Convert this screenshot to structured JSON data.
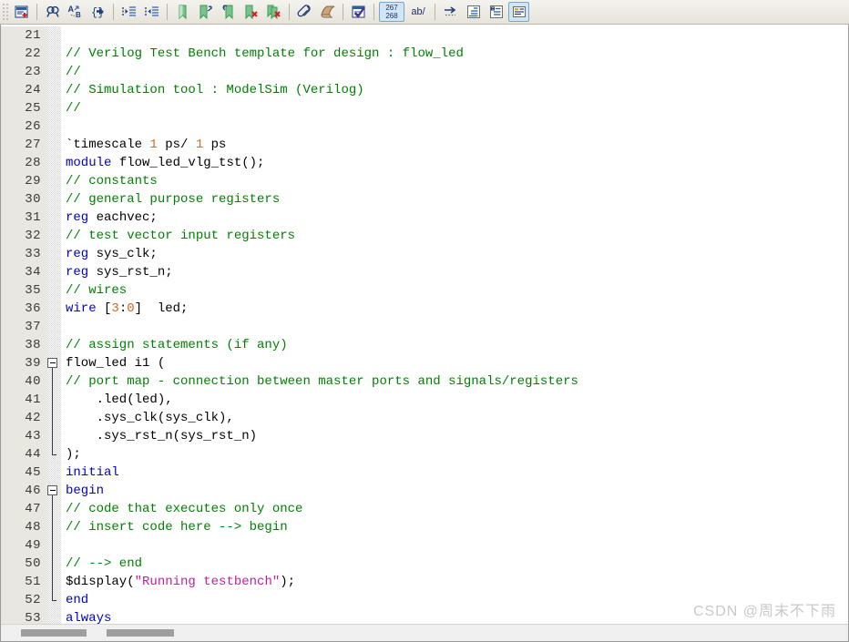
{
  "toolbar": {
    "items": [
      {
        "name": "insert-template-icon",
        "label": "Insert Template",
        "type": "icon",
        "active": false
      },
      {
        "name": "separator",
        "label": "",
        "type": "sep",
        "active": false
      },
      {
        "name": "find-icon",
        "label": "Find",
        "type": "icon",
        "active": false
      },
      {
        "name": "find-replace-icon",
        "label": "Find and Replace",
        "type": "icon",
        "active": false
      },
      {
        "name": "find-matching-delimiter-icon",
        "label": "Find Matching Delimiter",
        "type": "icon",
        "active": false
      },
      {
        "name": "separator",
        "label": "",
        "type": "sep",
        "active": false
      },
      {
        "name": "increase-indent-icon",
        "label": "Increase Indent",
        "type": "icon",
        "active": false
      },
      {
        "name": "decrease-indent-icon",
        "label": "Decrease Indent",
        "type": "icon",
        "active": false
      },
      {
        "name": "separator",
        "label": "",
        "type": "sep",
        "active": false
      },
      {
        "name": "insert-bookmark-icon",
        "label": "Insert Bookmark",
        "type": "icon",
        "active": false
      },
      {
        "name": "next-bookmark-icon",
        "label": "Next Bookmark",
        "type": "icon",
        "active": false
      },
      {
        "name": "previous-bookmark-icon",
        "label": "Previous Bookmark",
        "type": "icon",
        "active": false
      },
      {
        "name": "delete-bookmark-icon",
        "label": "Delete Bookmark",
        "type": "icon",
        "active": false
      },
      {
        "name": "delete-all-bookmarks-icon",
        "label": "Delete All Bookmarks",
        "type": "icon",
        "active": false
      },
      {
        "name": "separator",
        "label": "",
        "type": "sep",
        "active": false
      },
      {
        "name": "paperclip-icon",
        "label": "Attach",
        "type": "icon",
        "active": false
      },
      {
        "name": "scroll-icon",
        "label": "Insert File",
        "type": "icon",
        "active": false
      },
      {
        "name": "separator",
        "label": "",
        "type": "sep",
        "active": false
      },
      {
        "name": "check-syntax-icon",
        "label": "Check Syntax",
        "type": "icon",
        "active": false
      },
      {
        "name": "separator",
        "label": "",
        "type": "sep",
        "active": false
      },
      {
        "name": "line-numbers-icon",
        "label": "267 268",
        "type": "num",
        "active": true,
        "top": "267",
        "bottom": "268"
      },
      {
        "name": "toggle-word-wrap-icon",
        "label": "ab/",
        "type": "text",
        "active": false
      },
      {
        "name": "separator",
        "label": "",
        "type": "sep",
        "active": false
      },
      {
        "name": "show-whitespace-icon",
        "label": "Show Whitespace",
        "type": "icon",
        "active": false
      },
      {
        "name": "collapse-all-icon",
        "label": "Collapse All",
        "type": "icon",
        "active": false
      },
      {
        "name": "expand-all-icon",
        "label": "Expand All",
        "type": "icon",
        "active": false
      },
      {
        "name": "toggle-code-folding-icon",
        "label": "Toggle Code Folding",
        "type": "icon",
        "active": true
      }
    ]
  },
  "editor": {
    "language": "verilog",
    "colors": {
      "comment": "#008000",
      "keyword": "#0000c8",
      "number": "#d2691e",
      "string": "#c020a0",
      "plain": "#000000",
      "gutter_bg": "#e8e8e0",
      "editor_bg": "#ffffff"
    },
    "lines": [
      {
        "n": "21",
        "fold": "none",
        "tokens": []
      },
      {
        "n": "22",
        "fold": "none",
        "tokens": [
          {
            "t": "// Verilog Test Bench template for design : flow_led",
            "c": "com"
          }
        ]
      },
      {
        "n": "23",
        "fold": "none",
        "tokens": [
          {
            "t": "//",
            "c": "com"
          }
        ]
      },
      {
        "n": "24",
        "fold": "none",
        "tokens": [
          {
            "t": "// Simulation tool : ModelSim (Verilog)",
            "c": "com"
          }
        ]
      },
      {
        "n": "25",
        "fold": "none",
        "tokens": [
          {
            "t": "//",
            "c": "com"
          }
        ]
      },
      {
        "n": "26",
        "fold": "none",
        "tokens": []
      },
      {
        "n": "27",
        "fold": "none",
        "tokens": [
          {
            "t": "`timescale ",
            "c": "pln"
          },
          {
            "t": "1",
            "c": "num"
          },
          {
            "t": " ps/ ",
            "c": "pln"
          },
          {
            "t": "1",
            "c": "num"
          },
          {
            "t": " ps",
            "c": "pln"
          }
        ]
      },
      {
        "n": "28",
        "fold": "none",
        "tokens": [
          {
            "t": "module",
            "c": "kw"
          },
          {
            "t": " flow_led_vlg_tst();",
            "c": "pln"
          }
        ]
      },
      {
        "n": "29",
        "fold": "none",
        "tokens": [
          {
            "t": "// constants",
            "c": "com"
          }
        ]
      },
      {
        "n": "30",
        "fold": "none",
        "tokens": [
          {
            "t": "// general purpose registers",
            "c": "com"
          }
        ]
      },
      {
        "n": "31",
        "fold": "none",
        "tokens": [
          {
            "t": "reg",
            "c": "kw"
          },
          {
            "t": " eachvec;",
            "c": "pln"
          }
        ]
      },
      {
        "n": "32",
        "fold": "none",
        "tokens": [
          {
            "t": "// test vector input registers",
            "c": "com"
          }
        ]
      },
      {
        "n": "33",
        "fold": "none",
        "tokens": [
          {
            "t": "reg",
            "c": "kw"
          },
          {
            "t": " sys_clk;",
            "c": "pln"
          }
        ]
      },
      {
        "n": "34",
        "fold": "none",
        "tokens": [
          {
            "t": "reg",
            "c": "kw"
          },
          {
            "t": " sys_rst_n;",
            "c": "pln"
          }
        ]
      },
      {
        "n": "35",
        "fold": "none",
        "tokens": [
          {
            "t": "// wires",
            "c": "com"
          }
        ]
      },
      {
        "n": "36",
        "fold": "none",
        "tokens": [
          {
            "t": "wire",
            "c": "kw"
          },
          {
            "t": " [",
            "c": "pln"
          },
          {
            "t": "3",
            "c": "num"
          },
          {
            "t": ":",
            "c": "pln"
          },
          {
            "t": "0",
            "c": "num"
          },
          {
            "t": "]  led;",
            "c": "pln"
          }
        ]
      },
      {
        "n": "37",
        "fold": "none",
        "tokens": []
      },
      {
        "n": "38",
        "fold": "none",
        "tokens": [
          {
            "t": "// assign statements (if any)",
            "c": "com"
          }
        ]
      },
      {
        "n": "39",
        "fold": "start",
        "tokens": [
          {
            "t": "flow_led i1 (",
            "c": "pln"
          }
        ]
      },
      {
        "n": "40",
        "fold": "line",
        "tokens": [
          {
            "t": "// port map - connection between master ports and signals/registers",
            "c": "com"
          }
        ]
      },
      {
        "n": "41",
        "fold": "line",
        "tokens": [
          {
            "t": "    .led(led),",
            "c": "pln"
          }
        ]
      },
      {
        "n": "42",
        "fold": "line",
        "tokens": [
          {
            "t": "    .sys_clk(sys_clk),",
            "c": "pln"
          }
        ]
      },
      {
        "n": "43",
        "fold": "line",
        "tokens": [
          {
            "t": "    .sys_rst_n(sys_rst_n)",
            "c": "pln"
          }
        ]
      },
      {
        "n": "44",
        "fold": "end",
        "tokens": [
          {
            "t": ");",
            "c": "pln"
          }
        ]
      },
      {
        "n": "45",
        "fold": "none",
        "tokens": [
          {
            "t": "initial",
            "c": "kw"
          }
        ]
      },
      {
        "n": "46",
        "fold": "start",
        "tokens": [
          {
            "t": "begin",
            "c": "kw"
          }
        ]
      },
      {
        "n": "47",
        "fold": "line",
        "tokens": [
          {
            "t": "// code that executes only once",
            "c": "com"
          }
        ]
      },
      {
        "n": "48",
        "fold": "line",
        "tokens": [
          {
            "t": "// insert code here --> begin",
            "c": "com"
          }
        ]
      },
      {
        "n": "49",
        "fold": "line",
        "tokens": []
      },
      {
        "n": "50",
        "fold": "line",
        "tokens": [
          {
            "t": "// --> end",
            "c": "com"
          }
        ]
      },
      {
        "n": "51",
        "fold": "line",
        "tokens": [
          {
            "t": "$display(",
            "c": "pln"
          },
          {
            "t": "\"Running testbench\"",
            "c": "str"
          },
          {
            "t": ");",
            "c": "pln"
          }
        ]
      },
      {
        "n": "52",
        "fold": "end",
        "tokens": [
          {
            "t": "end",
            "c": "kw"
          }
        ]
      },
      {
        "n": "53",
        "fold": "none",
        "tokens": [
          {
            "t": "always",
            "c": "kw"
          }
        ]
      }
    ]
  },
  "scrollbar": {
    "orientation": "horizontal",
    "thumb_a_label": "",
    "thumb_b_label": ""
  },
  "watermark": {
    "text": "CSDN @周末不下雨"
  }
}
